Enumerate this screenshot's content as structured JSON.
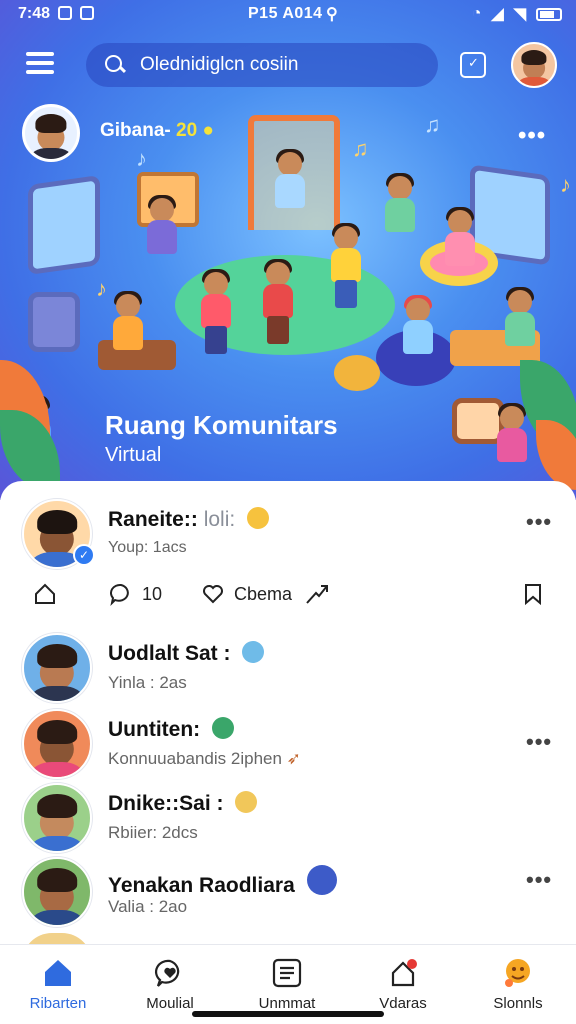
{
  "status_bar": {
    "time": "7:48",
    "center": "P15 A014"
  },
  "header": {
    "search_placeholder": "Olednidiglcn cosiin"
  },
  "hero": {
    "host_label": "Gibana-",
    "host_number": "20",
    "title": "Ruang Komunitars",
    "subtitle": "Virtual"
  },
  "post": {
    "author": "Raneite::",
    "author_tag": "loli:",
    "time": "Youp: 1acs",
    "comment_count": "10",
    "like_label": "Cbema"
  },
  "list": [
    {
      "name": "Uodlalt Sat :",
      "sub": "Yinla : 2as",
      "emoji_color": "#6fbbe8"
    },
    {
      "name": "Uuntiten:",
      "sub": "Konnuuabandis 2iphen",
      "emoji_color": "#3aa66a"
    },
    {
      "name": "Dnike::Sai :",
      "sub": "Rbiier: 2dcs",
      "emoji_color": "#f1c75a"
    },
    {
      "name": "Yenakan Raodliara",
      "sub": "Valia : 2ao",
      "emoji_color": "#3d5bc8"
    }
  ],
  "bottom_nav": [
    {
      "label": "Ribarten",
      "icon": "home-icon",
      "active": true
    },
    {
      "label": "Moulial",
      "icon": "chat-heart-icon",
      "active": false
    },
    {
      "label": "Unmmat",
      "icon": "list-icon",
      "active": false
    },
    {
      "label": "Vdaras",
      "icon": "notification-icon",
      "active": false
    },
    {
      "label": "Slonnls",
      "icon": "profile-icon",
      "active": false
    }
  ],
  "colors": {
    "accent": "#2f6bdf",
    "hero_bg": "#4a8ff0",
    "badge": "#e53935"
  }
}
